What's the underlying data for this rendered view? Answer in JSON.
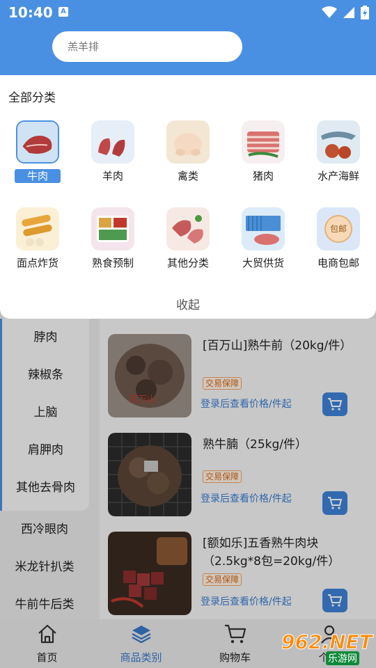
{
  "status": {
    "time": "10:40",
    "app_icon_letter": "A"
  },
  "search": {
    "placeholder": "羔羊排"
  },
  "panel": {
    "title": "全部分类",
    "collapse_label": "收起",
    "categories": [
      {
        "label": "牛肉",
        "selected": true
      },
      {
        "label": "羊肉"
      },
      {
        "label": "禽类"
      },
      {
        "label": "猪肉"
      },
      {
        "label": "水产海鲜"
      },
      {
        "label": "面点炸货"
      },
      {
        "label": "熟食预制"
      },
      {
        "label": "其他分类"
      },
      {
        "label": "大贸供货"
      },
      {
        "label": "电商包邮"
      }
    ],
    "ecommerce_badge_text": "包邮"
  },
  "sidebar": {
    "items": [
      "脖肉",
      "辣椒条",
      "上脑",
      "肩胛肉",
      "其他去骨肉",
      "西冷眼肉",
      "米龙针扒类",
      "牛前牛后类"
    ]
  },
  "products": [
    {
      "title": "[百万山]熟牛前（20kg/件）",
      "badge": "交易保障",
      "price_text": "登录后查看价格/件起",
      "bag_text": "百万山"
    },
    {
      "title": "熟牛腩（25kg/件）",
      "badge": "交易保障",
      "price_text": "登录后查看价格/件起"
    },
    {
      "title": "[额如乐]五香熟牛肉块（2.5kg*8包=20kg/件）",
      "badge": "交易保障",
      "price_text": "登录后查看价格/件起"
    }
  ],
  "bottom_nav": [
    {
      "label": "首页",
      "icon": "home-icon"
    },
    {
      "label": "商品类别",
      "icon": "layers-icon",
      "active": true
    },
    {
      "label": "购物车",
      "icon": "cart-icon"
    },
    {
      "label": "个人",
      "icon": "user-icon"
    }
  ],
  "watermark": {
    "brand": "962.NET",
    "sub": "乐游网"
  },
  "colors": {
    "primary": "#4a90e2",
    "price": "#3a7dd0",
    "badge": "#d26a1c"
  }
}
